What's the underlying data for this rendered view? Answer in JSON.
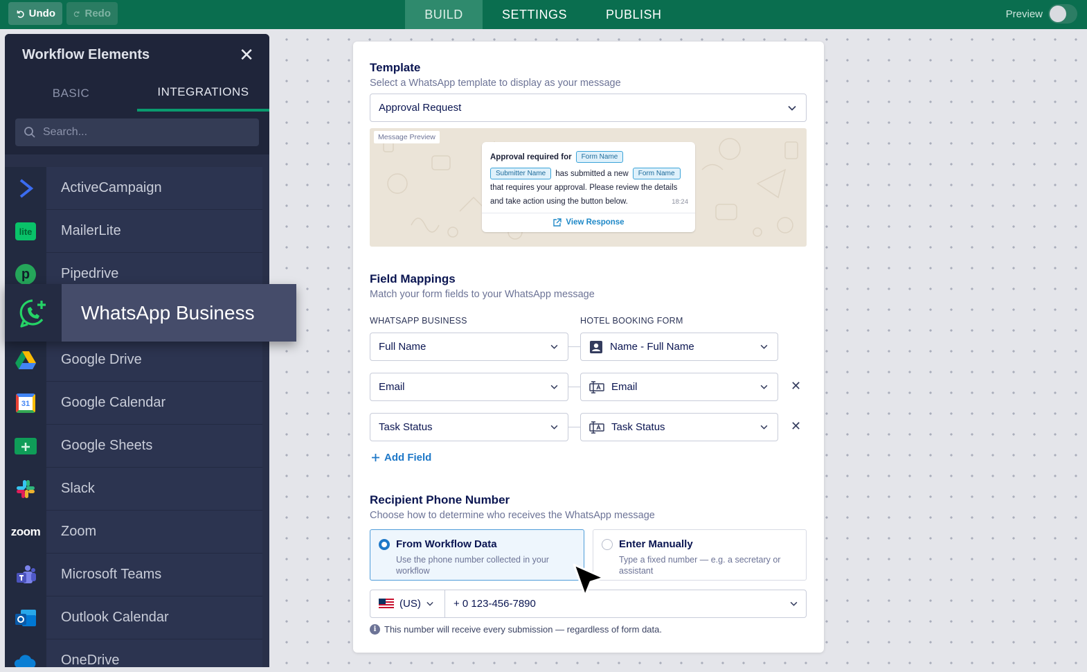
{
  "topbar": {
    "undo": "Undo",
    "redo": "Redo",
    "tabs": [
      "BUILD",
      "SETTINGS",
      "PUBLISH"
    ],
    "active_tab": "BUILD",
    "preview_label": "Preview",
    "preview_enabled": false
  },
  "sidebar": {
    "title": "Workflow Elements",
    "tabs": [
      "BASIC",
      "INTEGRATIONS"
    ],
    "active_tab": "INTEGRATIONS",
    "search_placeholder": "Search...",
    "items": [
      {
        "label": "ActiveCampaign",
        "icon": "activecampaign-icon"
      },
      {
        "label": "MailerLite",
        "icon": "mailerlite-icon"
      },
      {
        "label": "Pipedrive",
        "icon": "pipedrive-icon"
      },
      {
        "label": "WhatsApp Business",
        "icon": "whatsapp-icon"
      },
      {
        "label": "Google Drive",
        "icon": "google-drive-icon"
      },
      {
        "label": "Google Calendar",
        "icon": "google-calendar-icon"
      },
      {
        "label": "Google Sheets",
        "icon": "google-sheets-icon"
      },
      {
        "label": "Slack",
        "icon": "slack-icon"
      },
      {
        "label": "Zoom",
        "icon": "zoom-icon"
      },
      {
        "label": "Microsoft Teams",
        "icon": "microsoft-teams-icon"
      },
      {
        "label": "Outlook Calendar",
        "icon": "outlook-calendar-icon"
      },
      {
        "label": "OneDrive",
        "icon": "onedrive-icon"
      }
    ],
    "dragging_item": "WhatsApp Business",
    "calendar_day": "31",
    "zoom_text": "zoom"
  },
  "template": {
    "title": "Template",
    "subtitle": "Select a WhatsApp template to display as your message",
    "selected": "Approval Request",
    "preview": {
      "tag": "Message Preview",
      "line1_text": "Approval required for",
      "chip_form_name": "Form Name",
      "chip_submitter": "Submitter Name",
      "line2_text": "has submitted a new",
      "line3": "that requires your approval. Please review the details",
      "line4": "and take action using the button below.",
      "time": "18:24",
      "link": "View Response"
    }
  },
  "mappings": {
    "title": "Field Mappings",
    "subtitle": "Match your form fields to your WhatsApp message",
    "left_header": "WHATSAPP BUSINESS",
    "right_header": "HOTEL BOOKING FORM",
    "rows": [
      {
        "left": "Full Name",
        "right": "Name - Full Name",
        "right_icon": "contact-card-icon",
        "removable": false
      },
      {
        "left": "Email",
        "right": "Email",
        "right_icon": "text-field-icon",
        "removable": true
      },
      {
        "left": "Task Status",
        "right": "Task Status",
        "right_icon": "text-field-icon",
        "removable": true
      }
    ],
    "add_label": "Add Field"
  },
  "recipient": {
    "title": "Recipient Phone Number",
    "subtitle": "Choose how to determine who receives the WhatsApp message",
    "options": [
      {
        "title": "From Workflow Data",
        "desc": "Use the phone number collected in your workflow",
        "selected": true
      },
      {
        "title": "Enter Manually",
        "desc": "Type a fixed number — e.g. a secretary or assistant",
        "selected": false
      }
    ],
    "country": "(US)",
    "number": "+ 0 123-456-7890",
    "hint": "This number will receive every submission — regardless of form data."
  },
  "colors": {
    "topbar": "#0a6e4f",
    "sidebar": "#293049",
    "accent_blue": "#1e78c8",
    "tab_underline": "#0a9a6e"
  }
}
